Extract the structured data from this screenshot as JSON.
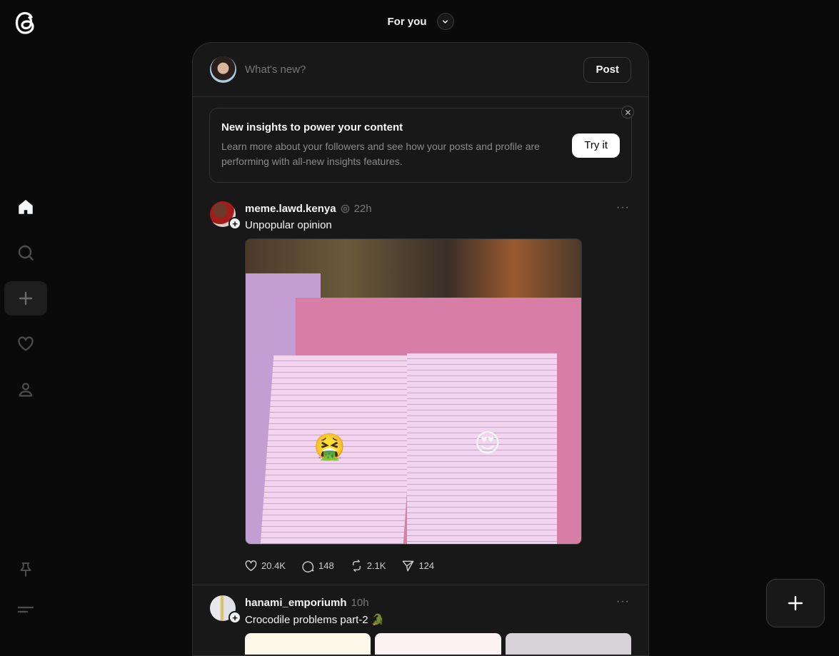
{
  "sidebar": {
    "logo": "threads-logo",
    "items": [
      {
        "name": "home",
        "icon": "home-icon",
        "active": true
      },
      {
        "name": "search",
        "icon": "search-icon",
        "active": false
      },
      {
        "name": "create",
        "icon": "plus-icon",
        "active": false
      },
      {
        "name": "activity",
        "icon": "heart-icon",
        "active": false
      },
      {
        "name": "profile",
        "icon": "person-icon",
        "active": false
      }
    ],
    "bottom": [
      {
        "name": "pinned",
        "icon": "pin-icon"
      },
      {
        "name": "menu",
        "icon": "menu-icon"
      }
    ]
  },
  "header": {
    "feed_title": "For you"
  },
  "composer": {
    "placeholder": "What's new?",
    "post_label": "Post"
  },
  "insight_card": {
    "title": "New insights to power your content",
    "body": "Learn more about your followers and see how your posts and profile are performing with all-new insights features.",
    "cta": "Try it"
  },
  "posts": [
    {
      "username": "meme.lawd.kenya",
      "time": "22h",
      "caption": "Unpopular opinion",
      "media_emojis": [
        "🤮",
        "😍"
      ],
      "stats": {
        "likes": "20.4K",
        "replies": "148",
        "reposts": "2.1K",
        "shares": "124"
      }
    },
    {
      "username": "hanami_emporiumh",
      "time": "10h",
      "caption": "Crocodile problems part-2 🐊"
    }
  ],
  "colors": {
    "background": "#0a0a0a",
    "card": "#181818",
    "border": "#2e2e2e",
    "text": "#f3f5f7",
    "muted": "#777777"
  }
}
